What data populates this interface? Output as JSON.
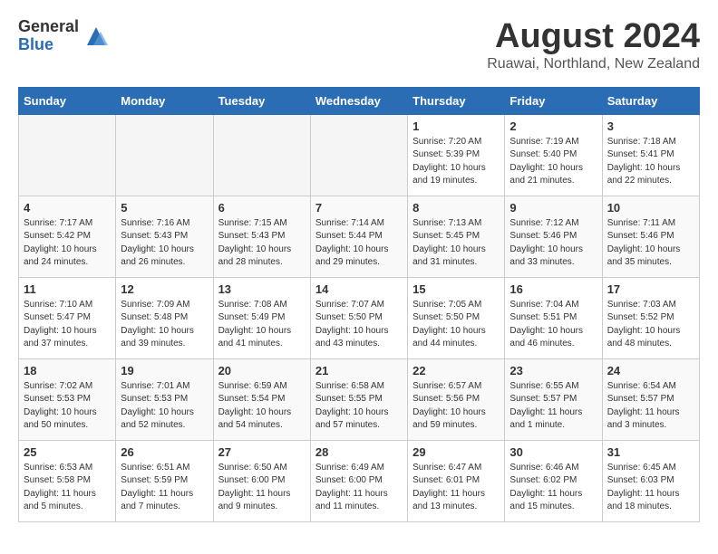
{
  "header": {
    "logo_general": "General",
    "logo_blue": "Blue",
    "month_title": "August 2024",
    "location": "Ruawai, Northland, New Zealand"
  },
  "weekdays": [
    "Sunday",
    "Monday",
    "Tuesday",
    "Wednesday",
    "Thursday",
    "Friday",
    "Saturday"
  ],
  "weeks": [
    [
      {
        "day": "",
        "info": ""
      },
      {
        "day": "",
        "info": ""
      },
      {
        "day": "",
        "info": ""
      },
      {
        "day": "",
        "info": ""
      },
      {
        "day": "1",
        "info": "Sunrise: 7:20 AM\nSunset: 5:39 PM\nDaylight: 10 hours\nand 19 minutes."
      },
      {
        "day": "2",
        "info": "Sunrise: 7:19 AM\nSunset: 5:40 PM\nDaylight: 10 hours\nand 21 minutes."
      },
      {
        "day": "3",
        "info": "Sunrise: 7:18 AM\nSunset: 5:41 PM\nDaylight: 10 hours\nand 22 minutes."
      }
    ],
    [
      {
        "day": "4",
        "info": "Sunrise: 7:17 AM\nSunset: 5:42 PM\nDaylight: 10 hours\nand 24 minutes."
      },
      {
        "day": "5",
        "info": "Sunrise: 7:16 AM\nSunset: 5:43 PM\nDaylight: 10 hours\nand 26 minutes."
      },
      {
        "day": "6",
        "info": "Sunrise: 7:15 AM\nSunset: 5:43 PM\nDaylight: 10 hours\nand 28 minutes."
      },
      {
        "day": "7",
        "info": "Sunrise: 7:14 AM\nSunset: 5:44 PM\nDaylight: 10 hours\nand 29 minutes."
      },
      {
        "day": "8",
        "info": "Sunrise: 7:13 AM\nSunset: 5:45 PM\nDaylight: 10 hours\nand 31 minutes."
      },
      {
        "day": "9",
        "info": "Sunrise: 7:12 AM\nSunset: 5:46 PM\nDaylight: 10 hours\nand 33 minutes."
      },
      {
        "day": "10",
        "info": "Sunrise: 7:11 AM\nSunset: 5:46 PM\nDaylight: 10 hours\nand 35 minutes."
      }
    ],
    [
      {
        "day": "11",
        "info": "Sunrise: 7:10 AM\nSunset: 5:47 PM\nDaylight: 10 hours\nand 37 minutes."
      },
      {
        "day": "12",
        "info": "Sunrise: 7:09 AM\nSunset: 5:48 PM\nDaylight: 10 hours\nand 39 minutes."
      },
      {
        "day": "13",
        "info": "Sunrise: 7:08 AM\nSunset: 5:49 PM\nDaylight: 10 hours\nand 41 minutes."
      },
      {
        "day": "14",
        "info": "Sunrise: 7:07 AM\nSunset: 5:50 PM\nDaylight: 10 hours\nand 43 minutes."
      },
      {
        "day": "15",
        "info": "Sunrise: 7:05 AM\nSunset: 5:50 PM\nDaylight: 10 hours\nand 44 minutes."
      },
      {
        "day": "16",
        "info": "Sunrise: 7:04 AM\nSunset: 5:51 PM\nDaylight: 10 hours\nand 46 minutes."
      },
      {
        "day": "17",
        "info": "Sunrise: 7:03 AM\nSunset: 5:52 PM\nDaylight: 10 hours\nand 48 minutes."
      }
    ],
    [
      {
        "day": "18",
        "info": "Sunrise: 7:02 AM\nSunset: 5:53 PM\nDaylight: 10 hours\nand 50 minutes."
      },
      {
        "day": "19",
        "info": "Sunrise: 7:01 AM\nSunset: 5:53 PM\nDaylight: 10 hours\nand 52 minutes."
      },
      {
        "day": "20",
        "info": "Sunrise: 6:59 AM\nSunset: 5:54 PM\nDaylight: 10 hours\nand 54 minutes."
      },
      {
        "day": "21",
        "info": "Sunrise: 6:58 AM\nSunset: 5:55 PM\nDaylight: 10 hours\nand 57 minutes."
      },
      {
        "day": "22",
        "info": "Sunrise: 6:57 AM\nSunset: 5:56 PM\nDaylight: 10 hours\nand 59 minutes."
      },
      {
        "day": "23",
        "info": "Sunrise: 6:55 AM\nSunset: 5:57 PM\nDaylight: 11 hours\nand 1 minute."
      },
      {
        "day": "24",
        "info": "Sunrise: 6:54 AM\nSunset: 5:57 PM\nDaylight: 11 hours\nand 3 minutes."
      }
    ],
    [
      {
        "day": "25",
        "info": "Sunrise: 6:53 AM\nSunset: 5:58 PM\nDaylight: 11 hours\nand 5 minutes."
      },
      {
        "day": "26",
        "info": "Sunrise: 6:51 AM\nSunset: 5:59 PM\nDaylight: 11 hours\nand 7 minutes."
      },
      {
        "day": "27",
        "info": "Sunrise: 6:50 AM\nSunset: 6:00 PM\nDaylight: 11 hours\nand 9 minutes."
      },
      {
        "day": "28",
        "info": "Sunrise: 6:49 AM\nSunset: 6:00 PM\nDaylight: 11 hours\nand 11 minutes."
      },
      {
        "day": "29",
        "info": "Sunrise: 6:47 AM\nSunset: 6:01 PM\nDaylight: 11 hours\nand 13 minutes."
      },
      {
        "day": "30",
        "info": "Sunrise: 6:46 AM\nSunset: 6:02 PM\nDaylight: 11 hours\nand 15 minutes."
      },
      {
        "day": "31",
        "info": "Sunrise: 6:45 AM\nSunset: 6:03 PM\nDaylight: 11 hours\nand 18 minutes."
      }
    ]
  ]
}
